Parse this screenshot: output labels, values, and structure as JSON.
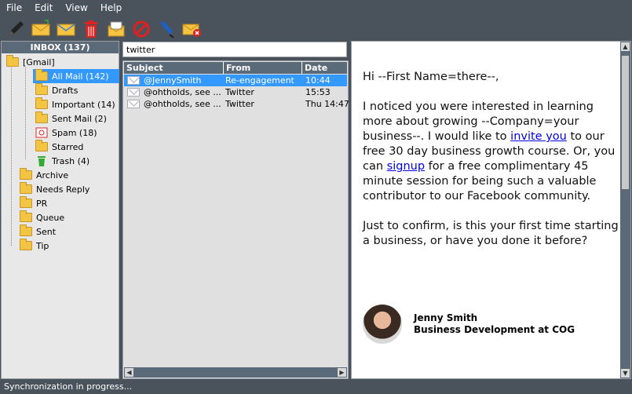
{
  "menu": [
    "File",
    "Edit",
    "View",
    "Help"
  ],
  "toolbar": [
    {
      "icon": "pencil-icon",
      "label": "compose"
    },
    {
      "icon": "envelope-new-icon",
      "label": "new"
    },
    {
      "icon": "envelope-icon",
      "label": "mail"
    },
    {
      "icon": "trash-icon",
      "label": "delete"
    },
    {
      "icon": "archive-mail-icon",
      "label": "archive"
    },
    {
      "icon": "block-icon",
      "label": "block"
    },
    {
      "icon": "pin-icon",
      "label": "pin"
    },
    {
      "icon": "envelope-close-icon",
      "label": "close"
    }
  ],
  "folders": {
    "header": "INBOX (137)",
    "gmail": "[Gmail]",
    "sub": [
      {
        "label": "All Mail (142)",
        "selected": true,
        "icon": "folder-icon"
      },
      {
        "label": "Drafts",
        "icon": "folder-icon"
      },
      {
        "label": "Important (14)",
        "icon": "folder-icon"
      },
      {
        "label": "Sent Mail (2)",
        "icon": "folder-icon"
      },
      {
        "label": "Spam (18)",
        "icon": "spam-icon"
      },
      {
        "label": "Starred",
        "icon": "folder-icon"
      },
      {
        "label": "Trash (4)",
        "icon": "trash-icon"
      }
    ],
    "top": [
      "Archive",
      "Needs Reply",
      "PR",
      "Queue",
      "Sent",
      "Tip"
    ]
  },
  "search": {
    "value": "twitter"
  },
  "list": {
    "columns": [
      "Subject",
      "From",
      "Date"
    ],
    "rows": [
      {
        "subject": "@JennySmith",
        "from": "Re-engagement",
        "date": "10:44",
        "selected": true
      },
      {
        "subject": "@ohtholds, see ...",
        "from": "Twitter",
        "date": "15:53"
      },
      {
        "subject": "@ohtholds, see ...",
        "from": "Twitter",
        "date": "Thu 14:47"
      }
    ]
  },
  "preview": {
    "greeting": "Hi --First Name=there--,",
    "p1_a": "I noticed you were interested in learning more about growing --Company=your business--. I would like to ",
    "link1": "invite you",
    "p1_b": " to our free 30 day business growth course. Or, you can ",
    "link2": "signup",
    "p1_c": " for a free complimentary 45 minute session for being such a valuable contributor to our Facebook community.",
    "p2": "Just to confirm, is this your first time starting a business, or have you done it before?",
    "sig_name": "Jenny Smith",
    "sig_title": "Business Development at COG"
  },
  "status": "Synchronization in progress..."
}
